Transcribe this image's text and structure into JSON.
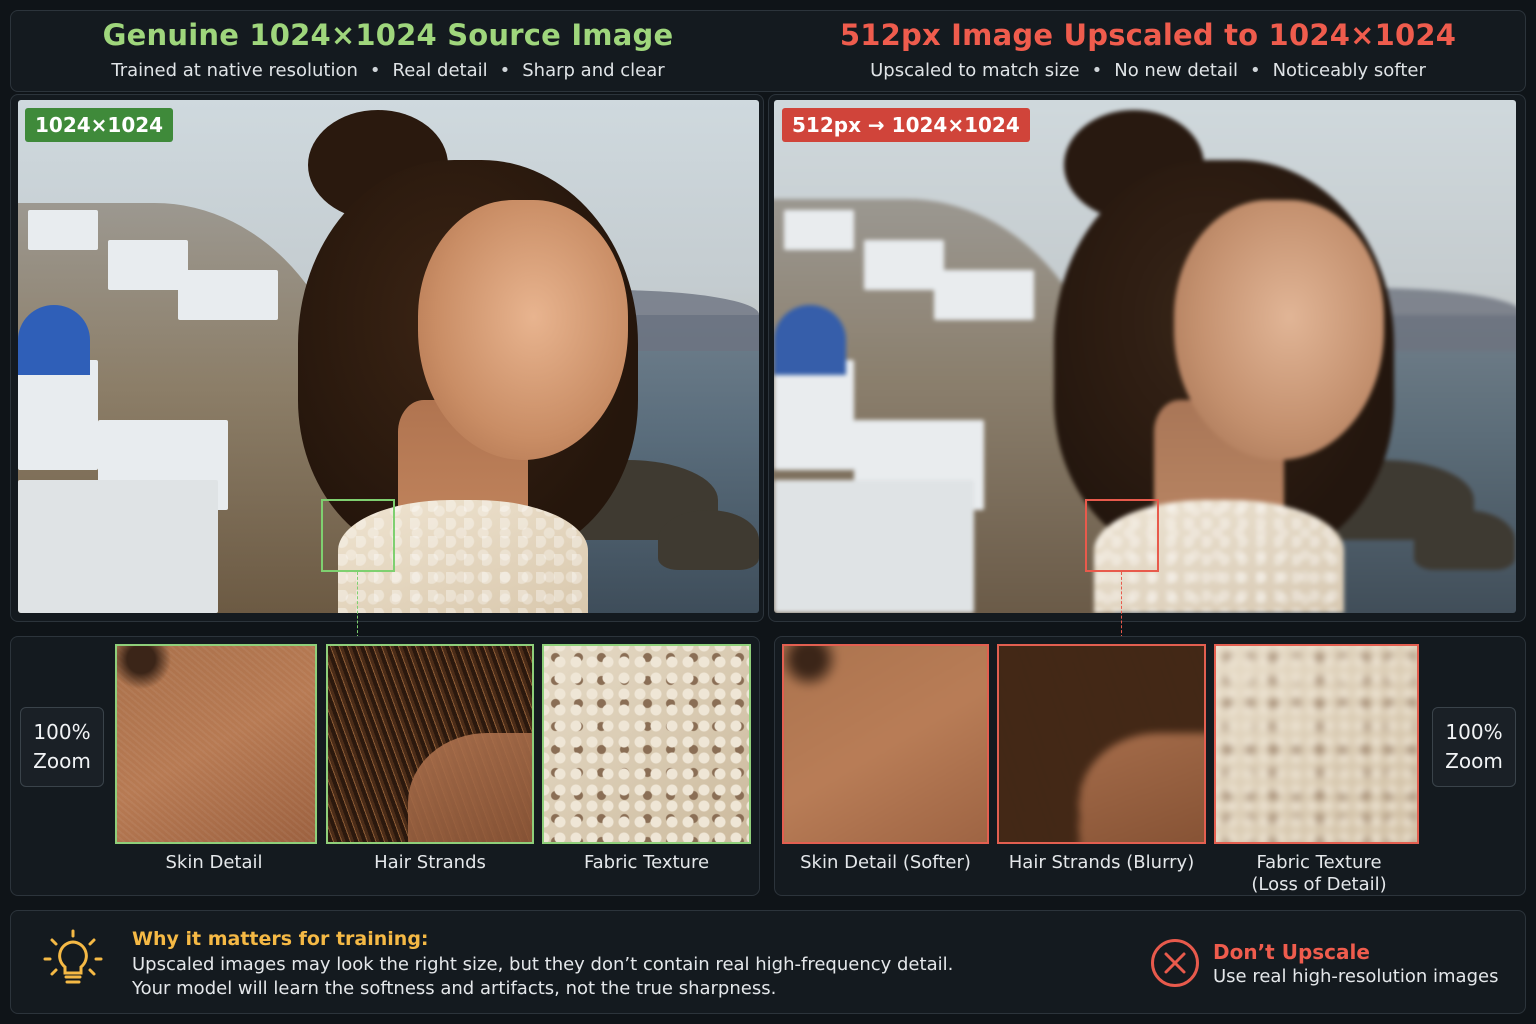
{
  "colors": {
    "good": "#9fd67c",
    "good_badge": "#3f8a3a",
    "bad": "#ef5c4d",
    "bad_badge": "#d0443a",
    "warning": "#f5b945",
    "background": "#0f1418"
  },
  "left": {
    "title": "Genuine 1024×1024 Source Image",
    "subtitle": [
      "Trained at native resolution",
      "Real detail",
      "Sharp and clear"
    ],
    "badge": "1024×1024",
    "zoom_label": [
      "100%",
      "Zoom"
    ],
    "crops": [
      {
        "label": "Skin Detail"
      },
      {
        "label": "Hair Strands"
      },
      {
        "label": "Fabric Texture"
      }
    ]
  },
  "right": {
    "title": "512px Image Upscaled to 1024×1024",
    "subtitle": [
      "Upscaled to match size",
      "No new detail",
      "Noticeably softer"
    ],
    "badge": "512px → 1024×1024",
    "zoom_label": [
      "100%",
      "Zoom"
    ],
    "crops": [
      {
        "label": "Skin Detail (Softer)"
      },
      {
        "label": "Hair Strands (Blurry)"
      },
      {
        "label": "Fabric Texture",
        "label2": "(Loss of Detail)"
      }
    ]
  },
  "footer": {
    "heading": "Why it matters for training:",
    "line1": "Upscaled images may look the right size, but they don’t contain real high-frequency detail.",
    "line2": "Your model will learn the softness and artifacts, not the true sharpness.",
    "cta_title": "Don’t Upscale",
    "cta_text": "Use real high-resolution images",
    "icons": {
      "tip": "lightbulb-icon",
      "cta": "x-circle-icon"
    }
  }
}
